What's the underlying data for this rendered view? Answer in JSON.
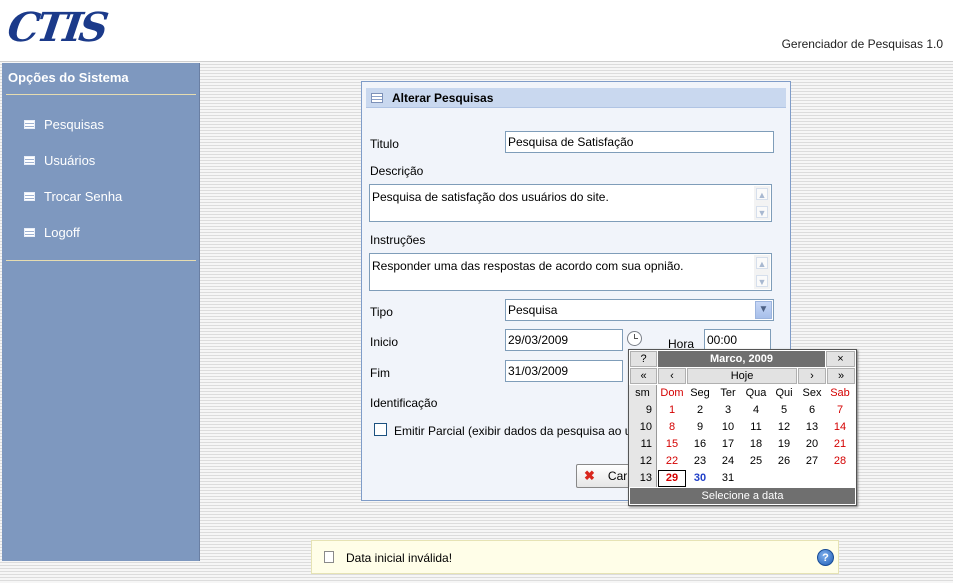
{
  "header": {
    "logo": "CTIS",
    "app_title": "Gerenciador de Pesquisas 1.0"
  },
  "sidebar": {
    "title": "Opções do Sistema",
    "items": [
      {
        "label": "Pesquisas",
        "icon": "list-icon"
      },
      {
        "label": "Usuários",
        "icon": "list-icon"
      },
      {
        "label": "Trocar Senha",
        "icon": "list-icon"
      },
      {
        "label": "Logoff",
        "icon": "list-icon"
      }
    ]
  },
  "form": {
    "title": "Alterar Pesquisas",
    "titulo_label": "Titulo",
    "titulo_value": "Pesquisa de Satisfação",
    "descricao_label": "Descrição",
    "descricao_value": "Pesquisa de satisfação dos usuários do site.",
    "instrucoes_label": "Instruções",
    "instrucoes_value": "Responder uma das respostas de acordo com sua opnião.",
    "tipo_label": "Tipo",
    "tipo_value": "Pesquisa",
    "inicio_label": "Inicio",
    "inicio_value": "29/03/2009",
    "hora_label": "Hora",
    "hora_value": "00:00",
    "fim_label": "Fim",
    "fim_value": "31/03/2009",
    "identificacao_label": "Identificação",
    "emitir_parcial_label": "Emitir Parcial (exibir dados da pesquisa ao usuá",
    "emitir_parcial_checked": false,
    "cancel_label": "Car"
  },
  "calendar": {
    "help": "?",
    "title": "Marco, 2009",
    "close": "×",
    "prev_year": "«",
    "prev_month": "‹",
    "today": "Hoje",
    "next_month": "›",
    "next_year": "»",
    "week_header": "sm",
    "day_names": [
      "Dom",
      "Seg",
      "Ter",
      "Qua",
      "Qui",
      "Sex",
      "Sab"
    ],
    "weeks": [
      {
        "week": "9",
        "days": [
          "1",
          "2",
          "3",
          "4",
          "5",
          "6",
          "7"
        ]
      },
      {
        "week": "10",
        "days": [
          "8",
          "9",
          "10",
          "11",
          "12",
          "13",
          "14"
        ]
      },
      {
        "week": "11",
        "days": [
          "15",
          "16",
          "17",
          "18",
          "19",
          "20",
          "21"
        ]
      },
      {
        "week": "12",
        "days": [
          "22",
          "23",
          "24",
          "25",
          "26",
          "27",
          "28"
        ]
      },
      {
        "week": "13",
        "days": [
          "29",
          "30",
          "31",
          "",
          "",
          "",
          ""
        ]
      }
    ],
    "selected_day": "29",
    "today_day": "30",
    "footer": "Selecione a data",
    "weekend_color": "#d40000",
    "today_color": "#1f3fc8"
  },
  "status": {
    "message": "Data inicial inválida!",
    "help_icon": "?"
  }
}
